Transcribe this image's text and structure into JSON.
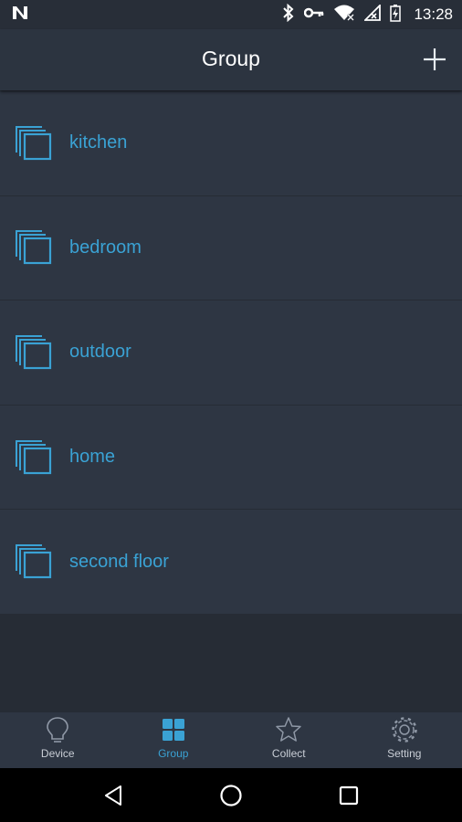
{
  "status_bar": {
    "time": "13:28",
    "icons": [
      "n-logo-icon",
      "bluetooth-icon",
      "key-icon",
      "wifi-icon",
      "signal-icon",
      "battery-charging-icon"
    ]
  },
  "app_bar": {
    "title": "Group",
    "action_icon": "plus-icon"
  },
  "groups": [
    {
      "label": "kitchen"
    },
    {
      "label": "bedroom"
    },
    {
      "label": "outdoor"
    },
    {
      "label": "home"
    },
    {
      "label": "second floor"
    }
  ],
  "bottom_nav": {
    "items": [
      {
        "label": "Device",
        "icon": "lightbulb-icon",
        "active": false
      },
      {
        "label": "Group",
        "icon": "grid-icon",
        "active": true
      },
      {
        "label": "Collect",
        "icon": "star-icon",
        "active": false
      },
      {
        "label": "Setting",
        "icon": "gear-icon",
        "active": false
      }
    ]
  },
  "system_nav": {
    "icons": [
      "back-icon",
      "home-icon",
      "recents-icon"
    ]
  },
  "colors": {
    "accent": "#3aa2d4",
    "app_bar": "#2c3440",
    "list_bg": "#2e3643",
    "background": "#262c35"
  }
}
